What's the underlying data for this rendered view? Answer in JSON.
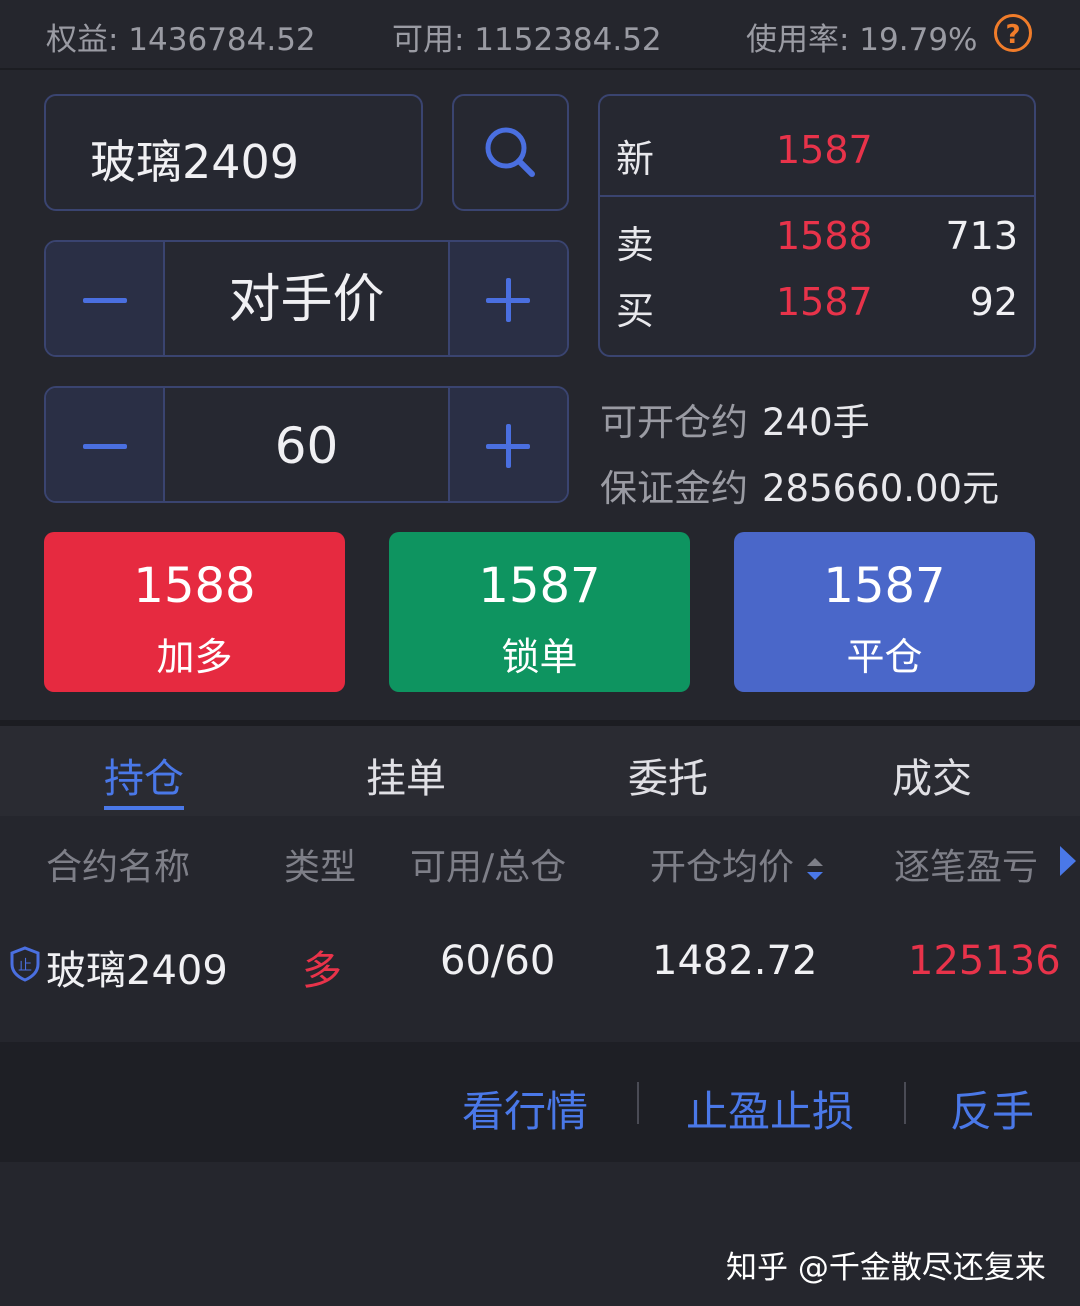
{
  "account": {
    "equity": "权益: 1436784.52",
    "available": "可用: 1152384.52",
    "usage": "使用率: 19.79%",
    "help": "?"
  },
  "order": {
    "symbol": "玻璃2409",
    "price_mode": "对手价",
    "quantity": "60"
  },
  "quote": {
    "last_label": "新",
    "last_price": "1587",
    "ask_label": "卖",
    "ask_price": "1588",
    "ask_volume": "713",
    "bid_label": "买",
    "bid_price": "1587",
    "bid_volume": "92"
  },
  "info": {
    "openable_label": "可开仓约",
    "openable_value": "240手",
    "margin_label": "保证金约",
    "margin_value": "285660.00元"
  },
  "actions": {
    "long_price": "1588",
    "long_label": "加多",
    "lock_price": "1587",
    "lock_label": "锁单",
    "close_price": "1587",
    "close_label": "平仓"
  },
  "tabs": [
    "持仓",
    "挂单",
    "委托",
    "成交"
  ],
  "table": {
    "headers": [
      "合约名称",
      "类型",
      "可用/总仓",
      "开仓均价",
      "逐笔盈亏"
    ],
    "rows": [
      {
        "badge": "止",
        "name": "玻璃2409",
        "type": "多",
        "qty": "60/60",
        "avg_price": "1482.72",
        "pnl": "125136"
      }
    ]
  },
  "row_actions": [
    "看行情",
    "止盈止损",
    "反手"
  ],
  "watermark": "知乎 @千金散尽还复来",
  "colors": {
    "red": "#e62a40",
    "green": "#0e9460",
    "blue": "#4a67c9",
    "accent": "#4a78e8",
    "orange": "#f07c2a"
  }
}
